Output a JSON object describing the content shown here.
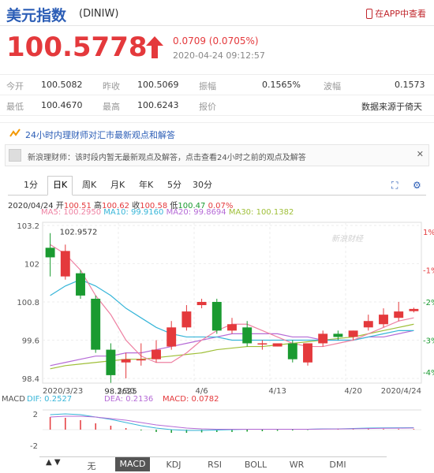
{
  "header": {
    "title": "美元指数",
    "code": "(DINIW)",
    "app_link": "在APP中查看"
  },
  "quote": {
    "price": "100.5778",
    "change": "0.0709 (0.0705%)",
    "datetime": "2020-04-24 09:12:57",
    "direction": "up",
    "up_color": "#e4393c"
  },
  "stats": [
    [
      {
        "label": "今开",
        "value": "100.5082"
      },
      {
        "label": "昨收",
        "value": "100.5069"
      },
      {
        "label": "振幅",
        "value": "0.1565%"
      },
      {
        "label": "波幅",
        "value": "0.1573"
      }
    ],
    [
      {
        "label": "最低",
        "value": "100.4670"
      },
      {
        "label": "最高",
        "value": "100.6243"
      },
      {
        "label": "报价",
        "value": "数据来源于倚天"
      }
    ]
  ],
  "news": {
    "headline": "24小时内理财师对汇市最新观点和解答",
    "notice": "新浪理财师：该时段内暂无最新观点及解答，点击查看24小时之前的观点及解答",
    "close_icon": "close-icon"
  },
  "tabs": [
    "1分",
    "日K",
    "周K",
    "月K",
    "年K",
    "5分",
    "30分"
  ],
  "active_tab": "日K",
  "ohlc_info": {
    "date": "2020/04/24",
    "open_label": "开",
    "open": "100.51",
    "high_label": "高",
    "high": "100.62",
    "close_label": "收",
    "close": "100.58",
    "low_label": "低",
    "low": "100.47",
    "pct": "0.07%"
  },
  "ma_info": {
    "ma5": "MA5: 100.2950",
    "ma10": "MA10: 99.9160",
    "ma20": "MA20: 99.8694",
    "ma30": "MA30: 100.1382"
  },
  "ma_colors": {
    "ma5": "#ee82a3",
    "ma10": "#36b5d8",
    "ma20": "#b56ad6",
    "ma30": "#9fbf38"
  },
  "watermark": "新浪财经",
  "chart_data": {
    "type": "candlestick",
    "title": "",
    "y_axis_left": [
      "103.2",
      "102",
      "100.8",
      "99.6",
      "98.4"
    ],
    "y_axis_right": [
      "1%",
      "-1%",
      "-2%",
      "-3%",
      "-4%"
    ],
    "x_ticks": [
      "2020/3/23",
      "3/30",
      "4/6",
      "4/13",
      "4/20",
      "2020/4/24"
    ],
    "ylim": [
      98.4,
      103.2
    ],
    "annotations": {
      "max": "102.9572",
      "min": "98.2625"
    },
    "candles": [
      {
        "date": "3/23",
        "o": 102.5,
        "h": 102.96,
        "l": 101.6,
        "c": 102.2
      },
      {
        "date": "3/24",
        "o": 101.6,
        "h": 102.6,
        "l": 101.5,
        "c": 102.4
      },
      {
        "date": "3/25",
        "o": 101.7,
        "h": 101.8,
        "l": 100.9,
        "c": 101.0
      },
      {
        "date": "3/26",
        "o": 100.9,
        "h": 101.0,
        "l": 99.2,
        "c": 99.3
      },
      {
        "date": "3/27",
        "o": 99.3,
        "h": 99.5,
        "l": 98.26,
        "c": 98.5
      },
      {
        "date": "3/30",
        "o": 98.9,
        "h": 99.2,
        "l": 98.4,
        "c": 99.0
      },
      {
        "date": "3/31",
        "o": 99.0,
        "h": 99.5,
        "l": 98.8,
        "c": 99.0
      },
      {
        "date": "4/1",
        "o": 99.0,
        "h": 99.6,
        "l": 98.9,
        "c": 99.3
      },
      {
        "date": "4/2",
        "o": 99.4,
        "h": 100.2,
        "l": 99.3,
        "c": 100.0
      },
      {
        "date": "4/3",
        "o": 100.0,
        "h": 100.7,
        "l": 99.9,
        "c": 100.5
      },
      {
        "date": "4/6",
        "o": 100.7,
        "h": 100.9,
        "l": 100.6,
        "c": 100.8
      },
      {
        "date": "4/7",
        "o": 100.8,
        "h": 100.9,
        "l": 99.8,
        "c": 99.9
      },
      {
        "date": "4/8",
        "o": 99.9,
        "h": 100.3,
        "l": 99.8,
        "c": 100.1
      },
      {
        "date": "4/9",
        "o": 100.0,
        "h": 100.2,
        "l": 99.4,
        "c": 99.5
      },
      {
        "date": "4/10",
        "o": 99.5,
        "h": 99.6,
        "l": 99.3,
        "c": 99.5
      },
      {
        "date": "4/13",
        "o": 99.4,
        "h": 99.5,
        "l": 99.4,
        "c": 99.5
      },
      {
        "date": "4/14",
        "o": 99.5,
        "h": 99.6,
        "l": 98.9,
        "c": 99.0
      },
      {
        "date": "4/15",
        "o": 98.9,
        "h": 99.5,
        "l": 98.8,
        "c": 99.5
      },
      {
        "date": "4/16",
        "o": 99.5,
        "h": 99.9,
        "l": 99.4,
        "c": 99.8
      },
      {
        "date": "4/17",
        "o": 99.8,
        "h": 99.9,
        "l": 99.6,
        "c": 99.7
      },
      {
        "date": "4/20",
        "o": 99.7,
        "h": 99.9,
        "l": 99.6,
        "c": 99.9
      },
      {
        "date": "4/21",
        "o": 100.0,
        "h": 100.4,
        "l": 99.9,
        "c": 100.2
      },
      {
        "date": "4/22",
        "o": 100.1,
        "h": 100.6,
        "l": 100.0,
        "c": 100.4
      },
      {
        "date": "4/23",
        "o": 100.3,
        "h": 100.8,
        "l": 100.2,
        "c": 100.5
      },
      {
        "date": "4/24",
        "o": 100.51,
        "h": 100.62,
        "l": 100.47,
        "c": 100.58
      }
    ],
    "ma": {
      "ma5": [
        102.6,
        102.3,
        101.8,
        101.0,
        100.4,
        99.6,
        99.1,
        98.9,
        98.9,
        99.2,
        99.6,
        99.9,
        100.1,
        100.1,
        99.9,
        99.7,
        99.5,
        99.4,
        99.4,
        99.5,
        99.6,
        99.8,
        100.0,
        100.2,
        100.3
      ],
      "ma10": [
        101.0,
        101.3,
        101.5,
        101.3,
        101.0,
        100.6,
        100.3,
        100.0,
        99.8,
        99.7,
        99.7,
        99.7,
        99.6,
        99.6,
        99.6,
        99.6,
        99.6,
        99.6,
        99.6,
        99.6,
        99.6,
        99.7,
        99.8,
        99.9,
        99.9
      ],
      "ma20": [
        98.8,
        98.9,
        99.0,
        99.1,
        99.1,
        99.2,
        99.2,
        99.3,
        99.4,
        99.5,
        99.6,
        99.7,
        99.8,
        99.8,
        99.8,
        99.8,
        99.7,
        99.7,
        99.6,
        99.6,
        99.6,
        99.7,
        99.7,
        99.8,
        99.9
      ],
      "ma30": [
        98.7,
        98.8,
        98.85,
        98.9,
        98.95,
        99.0,
        99.0,
        99.05,
        99.1,
        99.15,
        99.2,
        99.3,
        99.35,
        99.4,
        99.4,
        99.45,
        99.5,
        99.55,
        99.6,
        99.65,
        99.7,
        99.8,
        99.9,
        100.0,
        100.1
      ]
    },
    "macd": {
      "dif_label": "DIF: 0.2527",
      "dea_label": "DEA: 0.2136",
      "macd_label": "MACD: 0.0782",
      "y_ticks": [
        "2",
        "-2"
      ],
      "bars": [
        1.6,
        1.5,
        1.2,
        0.8,
        0.5,
        0.2,
        -0.1,
        -0.3,
        -0.4,
        -0.4,
        -0.35,
        -0.3,
        -0.3,
        -0.25,
        -0.2,
        -0.15,
        -0.1,
        -0.05,
        0.0,
        0.05,
        0.05,
        0.08,
        0.08,
        0.08,
        0.08
      ],
      "dif": [
        1.9,
        2.0,
        1.9,
        1.6,
        1.3,
        0.9,
        0.5,
        0.2,
        0.0,
        -0.1,
        -0.1,
        -0.05,
        0.0,
        0.05,
        0.05,
        0.05,
        0.05,
        0.05,
        0.1,
        0.1,
        0.15,
        0.2,
        0.22,
        0.24,
        0.25
      ],
      "dea": [
        1.6,
        1.7,
        1.7,
        1.6,
        1.4,
        1.2,
        0.9,
        0.6,
        0.4,
        0.2,
        0.1,
        0.05,
        0.05,
        0.05,
        0.05,
        0.05,
        0.05,
        0.05,
        0.07,
        0.09,
        0.11,
        0.14,
        0.17,
        0.19,
        0.21
      ]
    }
  },
  "indicators": [
    "无",
    "MACD",
    "KDJ",
    "RSI",
    "BOLL",
    "WR",
    "DMI"
  ],
  "active_indicator": "MACD"
}
